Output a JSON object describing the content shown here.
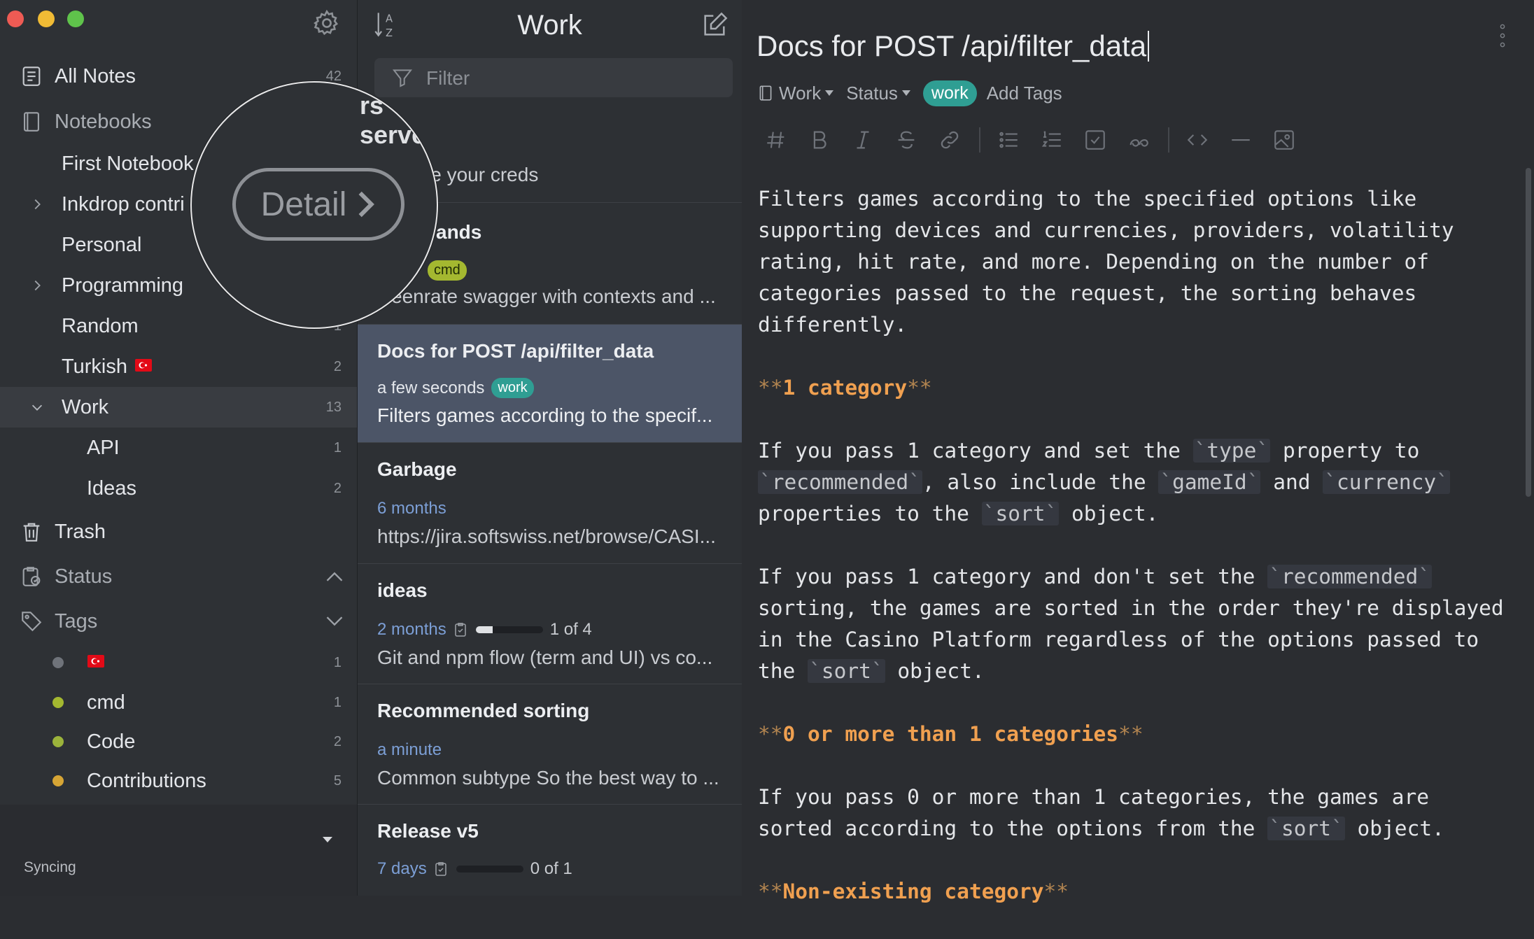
{
  "sidebar": {
    "all_notes": {
      "label": "All Notes",
      "count": "42"
    },
    "notebooks_header": "Notebooks",
    "notebooks": [
      {
        "label": "First Notebook",
        "count": "",
        "expandable": false
      },
      {
        "label": "Inkdrop contri",
        "count": "",
        "expandable": true
      },
      {
        "label": "Personal",
        "count": "",
        "expandable": false
      },
      {
        "label": "Programming",
        "count": "",
        "expandable": true
      },
      {
        "label": "Random",
        "count": "1",
        "expandable": false
      },
      {
        "label": "Turkish",
        "count": "2",
        "expandable": false
      },
      {
        "label": "Work",
        "count": "13",
        "expandable": true,
        "expanded": true
      },
      {
        "label": "API",
        "count": "1"
      },
      {
        "label": "Ideas",
        "count": "2"
      }
    ],
    "trash": "Trash",
    "status_header": "Status",
    "tags_header": "Tags",
    "tags": [
      {
        "label": "",
        "count": "1",
        "color": "#6f737a"
      },
      {
        "label": "cmd",
        "count": "1",
        "color": "#a4b830"
      },
      {
        "label": "Code",
        "count": "2",
        "color": "#9bb33b"
      },
      {
        "label": "Contributions",
        "count": "5",
        "color": "#d6a535"
      }
    ],
    "sync_status": "Syncing"
  },
  "note_list": {
    "title": "Work",
    "filter_placeholder": "Filter",
    "notes": [
      {
        "title": "",
        "meta": "",
        "snippet": "SH use your creds"
      },
      {
        "title": "ands",
        "tag": "cmd",
        "snippet": "eenrate swagger with contexts and ..."
      },
      {
        "title": "Docs for POST /api/filter_data",
        "meta": "a few seconds",
        "tag": "work",
        "snippet": "Filters games according to the specif..."
      },
      {
        "title": "Garbage",
        "meta": "6 months",
        "snippet": "https://jira.softswiss.net/browse/CASI..."
      },
      {
        "title": "ideas",
        "meta": "2 months",
        "progress_text": "1 of 4",
        "progress": 0.25,
        "snippet": "Git and npm flow (term and UI) vs co..."
      },
      {
        "title": "Recommended sorting",
        "meta": "a minute",
        "snippet": "Common subtype So the best way to ..."
      },
      {
        "title": "Release v5",
        "meta": "7 days",
        "progress_text": "0 of 1",
        "progress": 0.0,
        "snippet": ""
      }
    ]
  },
  "magnifier": {
    "ghost_text": "rs server",
    "button_label": "Detail"
  },
  "editor": {
    "title": "Docs for POST /api/filter_data",
    "notebook": "Work",
    "status": "Status",
    "tag": "work",
    "add_tags": "Add Tags",
    "toolbar": [
      "heading",
      "bold",
      "italic",
      "strikethrough",
      "link",
      "bullet-list",
      "numbered-list",
      "task-list",
      "quote",
      "code",
      "horizontal-rule",
      "image"
    ],
    "paragraphs": {
      "p1": "Filters games according to the specified options like\nsupporting devices and currencies, providers, volatility\nrating, hit rate, and more. Depending on the number of\ncategories passed to the request, the sorting behaves\ndifferently.",
      "h1": "1 category",
      "p2a": "If you pass 1 category and set the ",
      "p2_code1": "type",
      "p2b": " property to\n",
      "p2_code2": "recommended",
      "p2c": ", also include the ",
      "p2_code3": "gameId",
      "p2d": " and ",
      "p2_code4": "currency",
      "p2e": "\nproperties to the ",
      "p2_code5": "sort",
      "p2f": " object.",
      "p3a": "If you pass 1 category and don't set the ",
      "p3_code1": "recommended",
      "p3b": "\nsorting, the games are sorted in the order they're displayed\nin the Casino Platform regardless of the options passed to\nthe ",
      "p3_code2": "sort",
      "p3c": " object.",
      "h2": "0 or more than 1 categories",
      "p4a": "If you pass 0 or more than 1 categories, the games are\nsorted according to the options from the ",
      "p4_code1": "sort",
      "p4b": " object.",
      "h3": "Non-existing category"
    }
  },
  "colors": {
    "accent_tag": "#2f9e93",
    "cmd_tag": "#a4b830",
    "selection": "#4c5567",
    "heading": "#f0a050"
  }
}
